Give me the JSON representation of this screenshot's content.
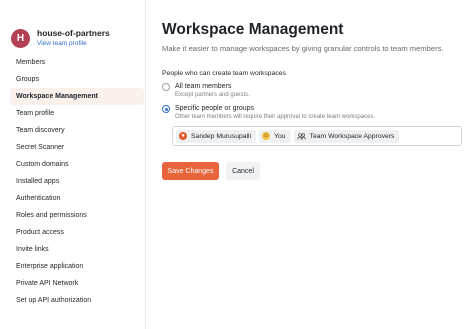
{
  "team": {
    "avatar_letter": "H",
    "name": "house-of-partners",
    "profile_link": "View team profile"
  },
  "sidebar": {
    "items": [
      {
        "label": "Members",
        "active": false
      },
      {
        "label": "Groups",
        "active": false
      },
      {
        "label": "Workspace Management",
        "active": true
      },
      {
        "label": "Team profile",
        "active": false
      },
      {
        "label": "Team discovery",
        "active": false
      },
      {
        "label": "Secret Scanner",
        "active": false
      },
      {
        "label": "Custom domains",
        "active": false
      },
      {
        "label": "Installed apps",
        "active": false
      },
      {
        "label": "Authentication",
        "active": false
      },
      {
        "label": "Roles and permissions",
        "active": false
      },
      {
        "label": "Product access",
        "active": false
      },
      {
        "label": "Invite links",
        "active": false
      },
      {
        "label": "Enterprise application",
        "active": false
      },
      {
        "label": "Private API Network",
        "active": false
      },
      {
        "label": "Set up API authorization",
        "active": false
      }
    ]
  },
  "main": {
    "title": "Workspace Management",
    "subtitle": "Make it easier to manage workspaces by giving granular controls to team members.",
    "section_label": "People who can create team workspaces",
    "options": [
      {
        "label": "All team members",
        "help": "Except partners and guests.",
        "checked": false
      },
      {
        "label": "Specific people or groups",
        "help": "Other team members will require their approval to create team workspaces.",
        "checked": true
      }
    ],
    "chips": [
      {
        "label": "Sandep Murusupalli",
        "icon": "user-avatar-icon"
      },
      {
        "label": "You",
        "icon": "user-avatar-icon"
      },
      {
        "label": "Team Workspace Approvers",
        "icon": "group-icon"
      }
    ],
    "save_label": "Save Changes",
    "cancel_label": "Cancel"
  },
  "colors": {
    "accent": "#e8643a",
    "link": "#2f6fd0",
    "avatar": "#b34155",
    "active_bg": "#fbf1ec"
  }
}
